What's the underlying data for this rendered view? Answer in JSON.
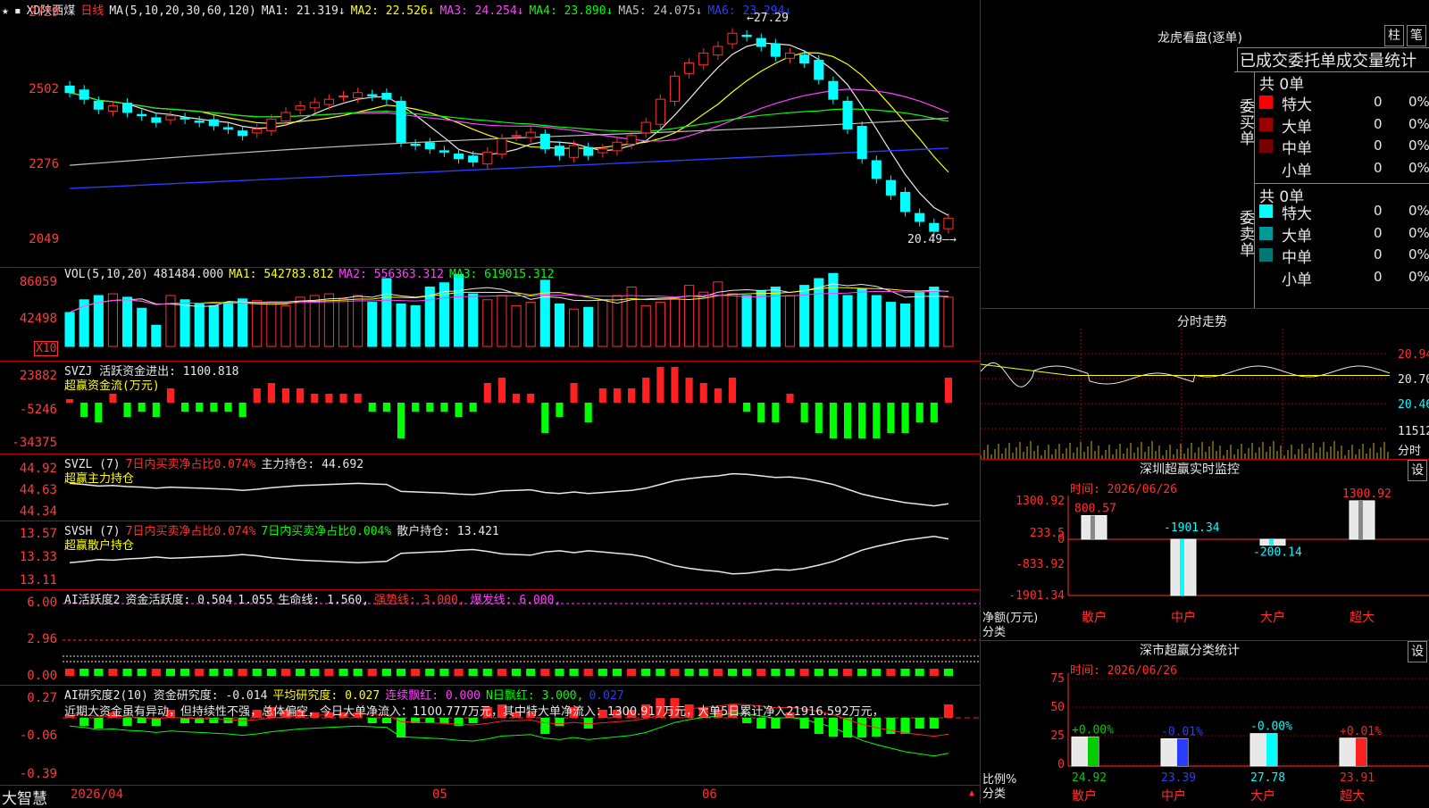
{
  "header": {
    "stock": "XD陕西煤",
    "period": "日线",
    "ma_label": "MA(5,10,20,30,60,120)",
    "ma": [
      {
        "label": "MA1:",
        "value": "21.319",
        "color": "#e8e8e8"
      },
      {
        "label": "MA2:",
        "value": "22.526",
        "color": "#ffff00"
      },
      {
        "label": "MA3:",
        "value": "24.254",
        "color": "#ff40ff"
      },
      {
        "label": "MA4:",
        "value": "23.890",
        "color": "#00ff00"
      },
      {
        "label": "MA5:",
        "value": "24.075",
        "color": "#c0c0c0"
      },
      {
        "label": "MA6:",
        "value": "23.294",
        "color": "#2a3cff"
      }
    ],
    "high_label": "27.29",
    "low_label": "20.49"
  },
  "price_axis": [
    "2729",
    "2502",
    "2276",
    "2049"
  ],
  "vol": {
    "title": "VOL(5,10,20)",
    "value": "481484.000",
    "ma1": "MA1: 542783.812",
    "ma2": "MA2: 556363.312",
    "ma3": "MA3: 619015.312",
    "axis": [
      "86059",
      "42498"
    ],
    "unit": "X10"
  },
  "svzj": {
    "title": "SVZJ  活跃资金进出: 1100.818",
    "sub": "超赢资金流(万元)",
    "axis": [
      "23882",
      "-5246",
      "-34375"
    ]
  },
  "svzl": {
    "title": "SVZL (7)",
    "t2": "7日内买卖净占比0.074%",
    "t3": "主力持仓: 44.692",
    "sub": "超赢主力持仓",
    "axis": [
      "44.92",
      "44.63",
      "44.34"
    ]
  },
  "svsh": {
    "title": "SVSH (7)",
    "t2": "7日内买卖净占比0.074%",
    "t3": "7日内买卖净占比0.004%",
    "t4": "散户持仓: 13.421",
    "sub": "超赢散户持仓",
    "axis": [
      "13.57",
      "13.33",
      "13.11"
    ]
  },
  "ai1": {
    "title": "AI活跃度2",
    "t2": "资金活跃度: 0.504",
    "t3": "1.055",
    "t4": "生命线: 1.560,",
    "t5": "强势线: 3.000,",
    "t6": "爆发线: 6.000,",
    "axis": [
      "6.00",
      "2.96",
      "0.00"
    ]
  },
  "ai2": {
    "title": "AI研究度2(10)",
    "t2": "资金研究度: -0.014",
    "t3": "平均研究度: 0.027",
    "t4": "连续飘红: 0.000",
    "t5": "N日飘红: 3.000,",
    "t6": "0.027",
    "comment": "近期大资金虽有异动，但持续性不强，总体偏空，今日大单净流入：1100.777万元，其中特大单净流入：1300.917万元，大单5日累计净入21916.592万元，",
    "axis": [
      "0.27",
      "-0.06",
      "-0.39"
    ]
  },
  "bottom": {
    "brand": "大智慧",
    "date": "2026/04",
    "m1": "05",
    "m2": "06"
  },
  "dragon": {
    "title": "龙虎看盘(逐单)",
    "btn1": "柱",
    "btn2": "笔",
    "subtitle": "已成交委托单成交量统计",
    "buy": {
      "label": "委买单",
      "total": "共 0单",
      "rows": [
        {
          "name": "特大",
          "v": "0",
          "p": "0%",
          "color": "#ff0000"
        },
        {
          "name": "大单",
          "v": "0",
          "p": "0%",
          "color": "#990000"
        },
        {
          "name": "中单",
          "v": "0",
          "p": "0%",
          "color": "#770000"
        },
        {
          "name": "小单",
          "v": "0",
          "p": "0%",
          "color": "#000000"
        }
      ]
    },
    "sell": {
      "label": "委卖单",
      "total": "共 0单",
      "rows": [
        {
          "name": "特大",
          "v": "0",
          "p": "0%",
          "color": "#00ffff"
        },
        {
          "name": "大单",
          "v": "0",
          "p": "0%",
          "color": "#009999"
        },
        {
          "name": "中单",
          "v": "0",
          "p": "0%",
          "color": "#007777"
        },
        {
          "name": "小单",
          "v": "0",
          "p": "0%",
          "color": "#000000"
        }
      ]
    }
  },
  "fenshi": {
    "title": "分时走势",
    "axis": [
      "20.94",
      "20.70",
      "20.46",
      "11512"
    ],
    "unit": "分时"
  },
  "sz_monitor": {
    "title": "深圳超赢实时监控",
    "btn": "设",
    "date": "时间: 2026/06/26",
    "axis": [
      "1300.92",
      "233.5",
      "0",
      "-833.92",
      "-1901.34"
    ],
    "ylabel": "净额(万元)",
    "xlabel": "分类",
    "cats": [
      "散户",
      "中户",
      "大户",
      "超大"
    ],
    "values": [
      800.57,
      -1901.34,
      -200.14,
      1300.92
    ],
    "labels": [
      "800.57",
      "-1901.34",
      "-200.14",
      "1300.92"
    ]
  },
  "sz_class": {
    "title": "深市超赢分类统计",
    "btn": "设",
    "date": "时间: 2026/06/26",
    "axis": [
      "75",
      "50",
      "25",
      "0"
    ],
    "ylabel": "比例%",
    "xlabel": "分类",
    "cats": [
      "散户",
      "中户",
      "大户",
      "超大"
    ],
    "values": [
      24.92,
      23.39,
      27.78,
      23.91
    ],
    "changes": [
      "+0.00%",
      "-0.01%",
      "-0.00%",
      "+0.01%"
    ],
    "colors": [
      "#00cc00",
      "#2a3cff",
      "#00ffff",
      "#ff2020"
    ]
  },
  "chart_data": [
    {
      "type": "candlestick",
      "title": "XD陕西煤 日线",
      "ylim": [
        20.49,
        27.29
      ],
      "high": 27.29,
      "low": 20.49,
      "close": [
        25.1,
        24.9,
        24.6,
        24.7,
        24.5,
        24.4,
        24.2,
        24.4,
        24.3,
        24.2,
        24.1,
        24.0,
        23.8,
        24.0,
        24.3,
        24.5,
        24.7,
        24.8,
        24.9,
        25.0,
        25.1,
        25.0,
        24.9,
        23.6,
        23.5,
        23.4,
        23.3,
        23.1,
        23.0,
        23.3,
        23.7,
        23.8,
        23.9,
        23.4,
        23.2,
        23.5,
        23.2,
        23.4,
        23.6,
        23.8,
        24.2,
        24.9,
        25.6,
        26.0,
        26.3,
        26.5,
        26.9,
        26.8,
        26.5,
        26.2,
        26.3,
        26.0,
        25.5,
        24.9,
        24.0,
        23.1,
        22.5,
        22.0,
        21.5,
        21.2,
        20.9,
        21.3
      ]
    },
    {
      "type": "bar",
      "title": "VOL(5,10,20)",
      "values": [
        40,
        55,
        60,
        62,
        58,
        45,
        25,
        60,
        55,
        50,
        48,
        52,
        56,
        54,
        52,
        48,
        58,
        60,
        62,
        56,
        60,
        52,
        80,
        50,
        48,
        70,
        75,
        85,
        62,
        55,
        60,
        48,
        52,
        78,
        50,
        44,
        46,
        55,
        60,
        70,
        48,
        52,
        56,
        72,
        64,
        76,
        62,
        60,
        66,
        70,
        60,
        72,
        80,
        86,
        60,
        68,
        60,
        52,
        50,
        64,
        70,
        58
      ]
    }
  ]
}
